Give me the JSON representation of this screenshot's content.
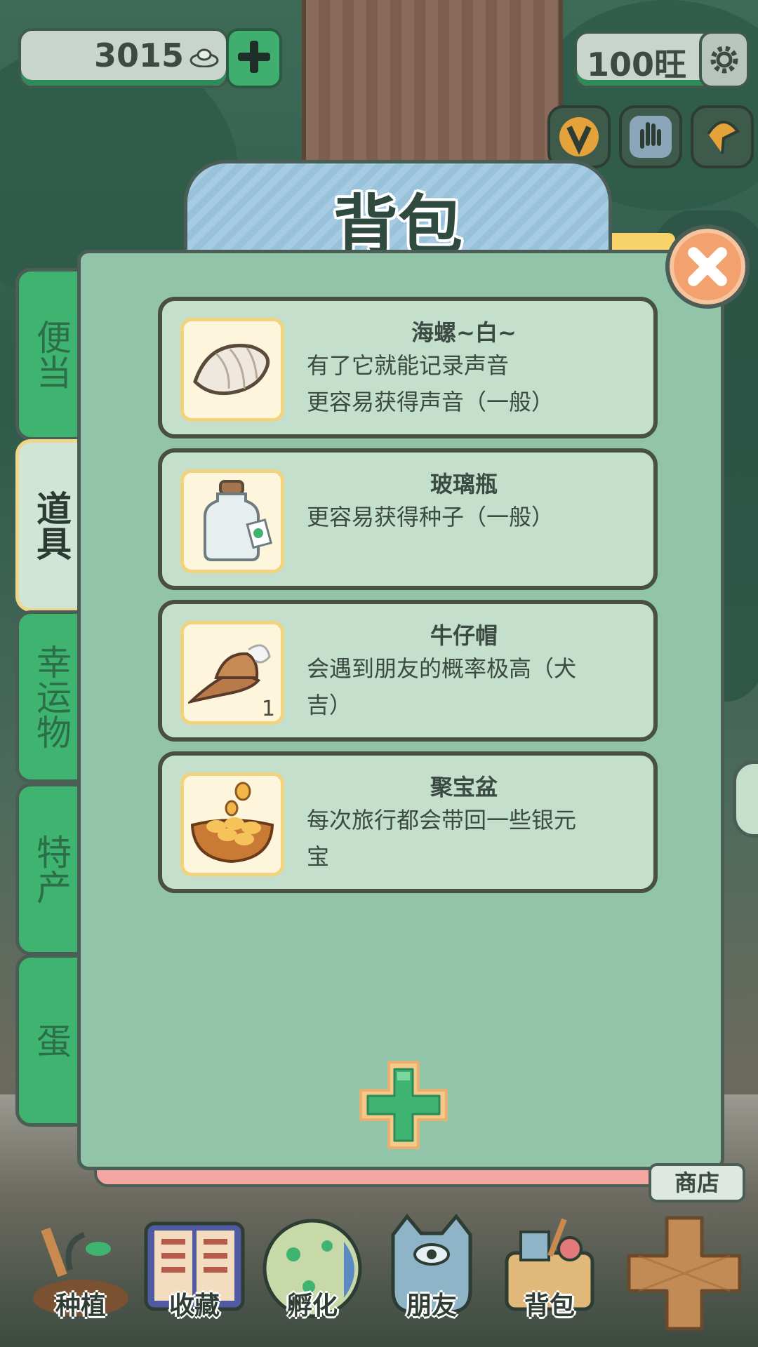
{
  "currency": {
    "coins": "3015",
    "wang": "100旺"
  },
  "top_icons": [
    "v-badge-icon",
    "hand-icon",
    "ginkgo-leaf-icon"
  ],
  "panel": {
    "title": "背包"
  },
  "categories": [
    {
      "label": "便当",
      "active": false
    },
    {
      "label": "道具",
      "active": true
    },
    {
      "label": "幸运物",
      "active": false
    },
    {
      "label": "特产",
      "active": false
    },
    {
      "label": "蛋",
      "active": false
    }
  ],
  "items": [
    {
      "name": "海螺~白~",
      "desc": [
        "有了它就能记录声音",
        "更容易获得声音（一般）"
      ],
      "icon": "conch-shell-icon",
      "count": ""
    },
    {
      "name": "玻璃瓶",
      "desc": [
        "更容易获得种子（一般）"
      ],
      "icon": "glass-bottle-icon",
      "count": ""
    },
    {
      "name": "牛仔帽",
      "desc": [
        "会遇到朋友的概率极高（犬",
        "吉）"
      ],
      "icon": "cowboy-hat-icon",
      "count": "1"
    },
    {
      "name": "聚宝盆",
      "desc": [
        "每次旅行都会带回一些银元",
        "宝"
      ],
      "icon": "treasure-bowl-icon",
      "count": ""
    }
  ],
  "bottom_nav": [
    {
      "label": "种植",
      "icon": "planting-icon"
    },
    {
      "label": "收藏",
      "icon": "collection-book-icon"
    },
    {
      "label": "孵化",
      "icon": "egg-icon"
    },
    {
      "label": "朋友",
      "icon": "cat-friend-icon"
    },
    {
      "label": "背包",
      "icon": "backpack-basket-icon"
    }
  ],
  "shop": {
    "label": "商店"
  },
  "colors": {
    "accent_green": "#3fb370",
    "panel_bg": "#92c4aa",
    "close_orange": "#f3a16e"
  }
}
